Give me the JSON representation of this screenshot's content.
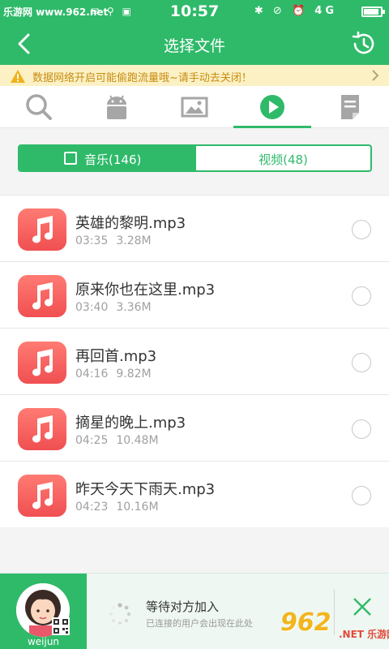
{
  "status_bar": {
    "watermark": "乐游网 www.962.net",
    "time": "10:57",
    "network": "4G"
  },
  "header": {
    "title": "选择文件"
  },
  "notice": {
    "text": "数据网络开启可能偷跑流量哦~请手动去关闭！"
  },
  "tabs": [
    {
      "icon": "search-icon",
      "active": false
    },
    {
      "icon": "android-icon",
      "active": false
    },
    {
      "icon": "image-icon",
      "active": false
    },
    {
      "icon": "play-icon",
      "active": true
    },
    {
      "icon": "document-icon",
      "active": false
    }
  ],
  "segment": {
    "music_label": "音乐(146)",
    "video_label": "视频(48)"
  },
  "files": [
    {
      "name": "英雄的黎明.mp3",
      "duration": "03:35",
      "size": "3.28M"
    },
    {
      "name": "原来你也在这里.mp3",
      "duration": "03:40",
      "size": "3.36M"
    },
    {
      "name": "再回首.mp3",
      "duration": "04:16",
      "size": "9.82M"
    },
    {
      "name": "摘星的晚上.mp3",
      "duration": "04:25",
      "size": "10.48M"
    },
    {
      "name": "昨天今天下雨天.mp3",
      "duration": "04:23",
      "size": "10.16M"
    }
  ],
  "bottom_bar": {
    "username": "weijun",
    "status": "等待对方加入",
    "hint": "已连接的用户会出现在此处"
  },
  "watermark_logo": {
    "logo": "962",
    "site": "乐游网",
    "domain": ".NET"
  },
  "colors": {
    "primary": "#2fba6a",
    "notice_bg": "#fbf1c4",
    "notice_text": "#c98b12",
    "music_icon": "#f04f51"
  }
}
